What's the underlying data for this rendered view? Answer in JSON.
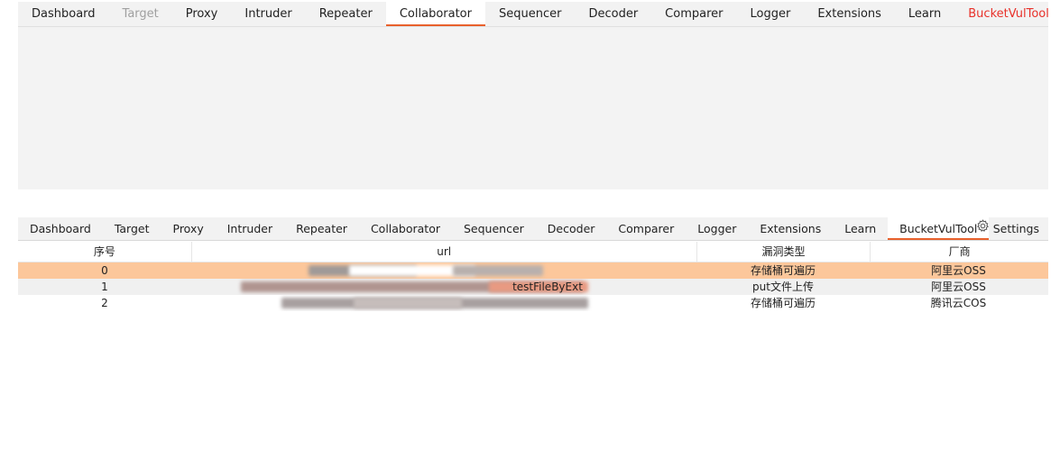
{
  "top_tabs": [
    {
      "label": "Dashboard",
      "state": "normal"
    },
    {
      "label": "Target",
      "state": "muted"
    },
    {
      "label": "Proxy",
      "state": "normal"
    },
    {
      "label": "Intruder",
      "state": "normal"
    },
    {
      "label": "Repeater",
      "state": "normal"
    },
    {
      "label": "Collaborator",
      "state": "active"
    },
    {
      "label": "Sequencer",
      "state": "normal"
    },
    {
      "label": "Decoder",
      "state": "normal"
    },
    {
      "label": "Comparer",
      "state": "normal"
    },
    {
      "label": "Logger",
      "state": "normal"
    },
    {
      "label": "Extensions",
      "state": "normal"
    },
    {
      "label": "Learn",
      "state": "normal"
    },
    {
      "label": "BucketVulTool",
      "state": "extension"
    }
  ],
  "bottom_tabs": [
    {
      "label": "Dashboard"
    },
    {
      "label": "Target"
    },
    {
      "label": "Proxy"
    },
    {
      "label": "Intruder"
    },
    {
      "label": "Repeater"
    },
    {
      "label": "Collaborator"
    },
    {
      "label": "Sequencer"
    },
    {
      "label": "Decoder"
    },
    {
      "label": "Comparer"
    },
    {
      "label": "Logger"
    },
    {
      "label": "Extensions"
    },
    {
      "label": "Learn"
    },
    {
      "label": "BucketVulTool",
      "active": true
    }
  ],
  "settings": {
    "label": "Settings",
    "icon": "gear-icon"
  },
  "table": {
    "columns": [
      "序号",
      "url",
      "漏洞类型",
      "厂商"
    ],
    "rows": [
      {
        "index": "0",
        "url": "",
        "vuln": "存储桶可遍历",
        "vendor": "阿里云OSS",
        "selected": true
      },
      {
        "index": "1",
        "url": "testFileByExt",
        "vuln": "put文件上传",
        "vendor": "阿里云OSS"
      },
      {
        "index": "2",
        "url": "",
        "vuln": "存储桶可遍历",
        "vendor": "腾讯云COS"
      }
    ]
  },
  "colors": {
    "accent": "#e8612c",
    "extension_tab": "#e8312a",
    "selected_row": "#fcc79b"
  }
}
